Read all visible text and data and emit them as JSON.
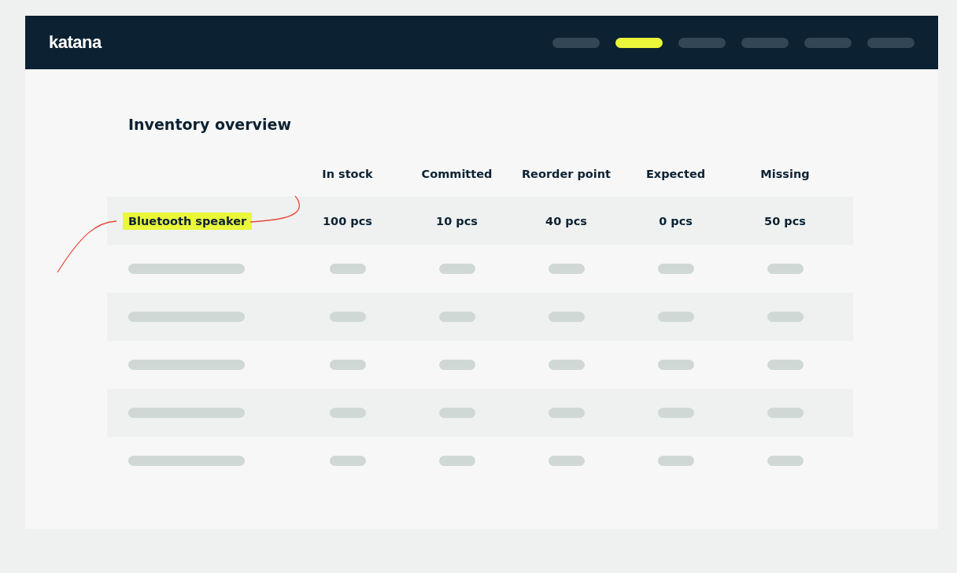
{
  "header": {
    "logo": "katana",
    "nav_items": [
      {
        "selected": false
      },
      {
        "selected": true
      },
      {
        "selected": false
      },
      {
        "selected": false
      },
      {
        "selected": false
      },
      {
        "selected": false
      }
    ]
  },
  "page_title": "Inventory overview",
  "table": {
    "columns": [
      "In stock",
      "Committed",
      "Reorder point",
      "Expected",
      "Missing"
    ],
    "rows": [
      {
        "kind": "item",
        "name": "Bluetooth speaker",
        "highlighted": true,
        "values": [
          "100 pcs",
          "10 pcs",
          "40 pcs",
          "0 pcs",
          "50 pcs"
        ]
      },
      {
        "kind": "skeleton"
      },
      {
        "kind": "skeleton"
      },
      {
        "kind": "skeleton"
      },
      {
        "kind": "skeleton"
      },
      {
        "kind": "skeleton"
      }
    ]
  }
}
